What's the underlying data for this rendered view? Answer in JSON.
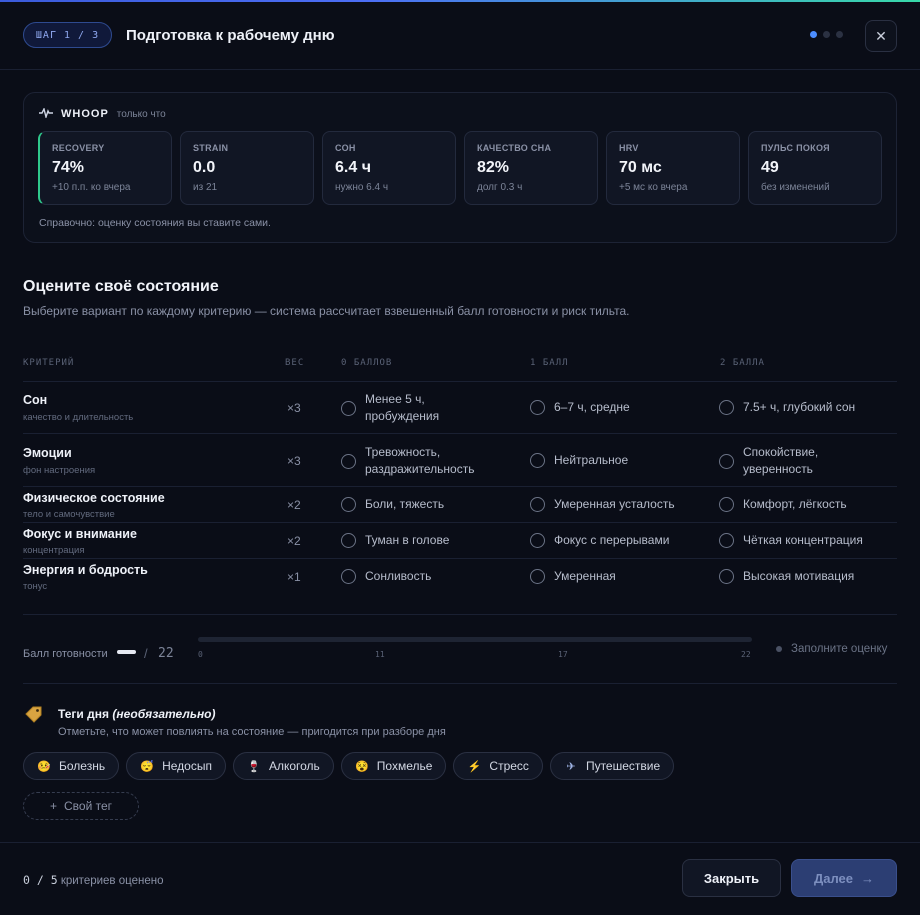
{
  "header": {
    "step": "ШАГ 1 / 3",
    "title": "Подготовка к рабочему дню",
    "close_glyph": "✕"
  },
  "whoop": {
    "brand": "WHOOP",
    "time": "только что",
    "metrics": [
      {
        "label": "RECOVERY",
        "value": "74%",
        "sub": "+10 п.п. ко вчера"
      },
      {
        "label": "STRAIN",
        "value": "0.0",
        "sub": "из 21"
      },
      {
        "label": "СОН",
        "value": "6.4 ч",
        "sub": "нужно 6.4 ч"
      },
      {
        "label": "КАЧЕСТВО СНА",
        "value": "82%",
        "sub": "долг 0.3 ч"
      },
      {
        "label": "HRV",
        "value": "70 мс",
        "sub": "+5 мс ко вчера"
      },
      {
        "label": "ПУЛЬС ПОКОЯ",
        "value": "49",
        "sub": "без изменений"
      }
    ],
    "note": "Справочно: оценку состояния вы ставите сами.",
    "accent_color": "#2fc98c"
  },
  "assessment": {
    "title": "Оцените своё состояние",
    "subtitle": "Выберите вариант по каждому критерию — система рассчитает взвешенный балл готовности и риск тильта.",
    "columns": {
      "criterion": "КРИТЕРИЙ",
      "weight": "ВЕС",
      "score0": "0 БАЛЛОВ",
      "score1": "1 БАЛЛ",
      "score2": "2 БАЛЛА"
    },
    "rows": [
      {
        "name": "Сон",
        "sub": "качество и длительность",
        "weight": "×3",
        "opt0": "Менее 5 ч, пробуждения",
        "opt1": "6–7 ч, средне",
        "opt2": "7.5+ ч, глубокий сон"
      },
      {
        "name": "Эмоции",
        "sub": "фон настроения",
        "weight": "×3",
        "opt0": "Тревожность, раздражительность",
        "opt1": "Нейтральное",
        "opt2": "Спокойствие, уверенность"
      },
      {
        "name": "Физическое состояние",
        "sub": "тело и самочувствие",
        "weight": "×2",
        "opt0": "Боли, тяжесть",
        "opt1": "Умеренная усталость",
        "opt2": "Комфорт, лёгкость"
      },
      {
        "name": "Фокус и внимание",
        "sub": "концентрация",
        "weight": "×2",
        "opt0": "Туман в голове",
        "opt1": "Фокус с перерывами",
        "opt2": "Чёткая концентрация"
      },
      {
        "name": "Энергия и бодрость",
        "sub": "тонус",
        "weight": "×1",
        "opt0": "Сонливость",
        "opt1": "Умеренная",
        "opt2": "Высокая мотивация"
      }
    ]
  },
  "readiness": {
    "label": "Балл готовности",
    "separator": "/",
    "max": "22",
    "ticks": [
      "0",
      "11",
      "17",
      "22"
    ],
    "status": "Заполните оценку"
  },
  "tags": {
    "title": "Теги дня",
    "optional": "(необязательно)",
    "subtitle": "Отметьте, что может повлиять на состояние — пригодится при разборе дня",
    "items": [
      {
        "icon": "sick-face-icon",
        "glyph": "🤒",
        "label": "Болезнь"
      },
      {
        "icon": "sleepy-face-icon",
        "glyph": "😴",
        "label": "Недосып"
      },
      {
        "icon": "wine-glass-icon",
        "glyph": "🍷",
        "label": "Алкоголь"
      },
      {
        "icon": "hangover-face-icon",
        "glyph": "😵",
        "label": "Похмелье"
      },
      {
        "icon": "lightning-icon",
        "glyph": "⚡",
        "label": "Стресс"
      },
      {
        "icon": "airplane-icon",
        "glyph": "✈",
        "label": "Путешествие"
      }
    ],
    "own_tag": "Свой тег",
    "own_tag_glyph": "+"
  },
  "footer": {
    "count": "0 / 5",
    "count_text": "критериев оценено",
    "close_label": "Закрыть",
    "next_label": "Далее",
    "next_glyph": "→"
  }
}
